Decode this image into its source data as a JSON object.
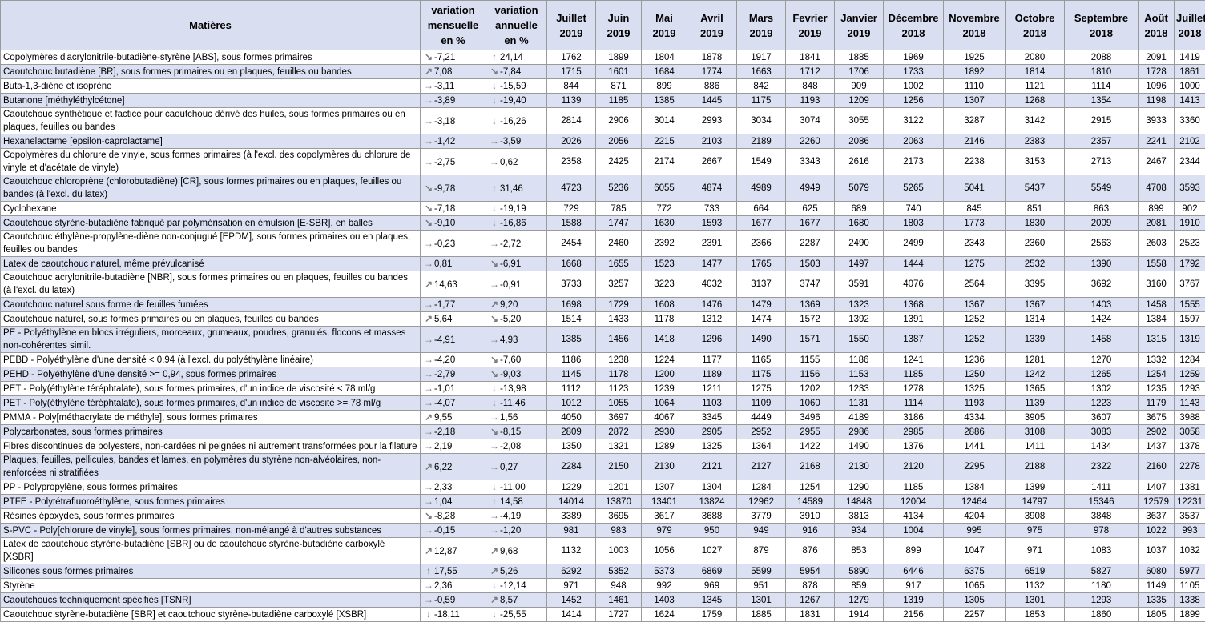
{
  "headers": {
    "matieres": "Matières",
    "var_mensuelle": [
      "variation",
      "mensuelle",
      "en %"
    ],
    "var_annuelle": [
      "variation",
      "annuelle",
      "en %"
    ],
    "months": [
      [
        "Juillet",
        "2019"
      ],
      [
        "Juin",
        "2019"
      ],
      [
        "Mai",
        "2019"
      ],
      [
        "Avril",
        "2019"
      ],
      [
        "Mars",
        "2019"
      ],
      [
        "Fevrier",
        "2019"
      ],
      [
        "Janvier",
        "2019"
      ],
      [
        "Décembre",
        "2018"
      ],
      [
        "Novembre",
        "2018"
      ],
      [
        "Octobre",
        "2018"
      ],
      [
        "Septembre",
        "2018"
      ],
      [
        "Août",
        "2018"
      ],
      [
        "Juillet",
        "2018"
      ]
    ]
  },
  "rows": [
    {
      "name": "Copolymères d'acrylonitrile-butadiène-styrène [ABS], sous formes primaires",
      "vm": "-7,21",
      "vm_dir": "down-right",
      "va": "24,14",
      "va_dir": "up",
      "values": [
        "1762",
        "1899",
        "1804",
        "1878",
        "1917",
        "1841",
        "1885",
        "1969",
        "1925",
        "2080",
        "2088",
        "2091",
        "1419"
      ]
    },
    {
      "name": "Caoutchouc butadiène [BR], sous formes primaires ou en plaques, feuilles ou bandes",
      "vm": "7,08",
      "vm_dir": "up-right",
      "va": "-7,84",
      "va_dir": "down-right",
      "values": [
        "1715",
        "1601",
        "1684",
        "1774",
        "1663",
        "1712",
        "1706",
        "1733",
        "1892",
        "1814",
        "1810",
        "1728",
        "1861"
      ]
    },
    {
      "name": "Buta-1,3-diène et isoprène",
      "vm": "-3,11",
      "vm_dir": "right",
      "va": "-15,59",
      "va_dir": "down",
      "values": [
        "844",
        "871",
        "899",
        "886",
        "842",
        "848",
        "909",
        "1002",
        "1110",
        "1121",
        "1114",
        "1096",
        "1000"
      ]
    },
    {
      "name": "Butanone [méthyléthylcétone]",
      "vm": "-3,89",
      "vm_dir": "right",
      "va": "-19,40",
      "va_dir": "down",
      "values": [
        "1139",
        "1185",
        "1385",
        "1445",
        "1175",
        "1193",
        "1209",
        "1256",
        "1307",
        "1268",
        "1354",
        "1198",
        "1413"
      ]
    },
    {
      "name": "Caoutchouc synthétique et factice pour caoutchouc dérivé des huiles, sous formes primaires ou en plaques, feuilles ou bandes",
      "vm": "-3,18",
      "vm_dir": "right",
      "va": "-16,26",
      "va_dir": "down",
      "values": [
        "2814",
        "2906",
        "3014",
        "2993",
        "3034",
        "3074",
        "3055",
        "3122",
        "3287",
        "3142",
        "2915",
        "3933",
        "3360"
      ]
    },
    {
      "name": "Hexanelactame [epsilon-caprolactame]",
      "vm": "-1,42",
      "vm_dir": "right",
      "va": "-3,59",
      "va_dir": "right",
      "values": [
        "2026",
        "2056",
        "2215",
        "2103",
        "2189",
        "2260",
        "2086",
        "2063",
        "2146",
        "2383",
        "2357",
        "2241",
        "2102"
      ]
    },
    {
      "name": "Copolymères du chlorure de vinyle, sous formes primaires (à l'excl. des copolymères du chlorure de vinyle et d'acétate de vinyle)",
      "vm": "-2,75",
      "vm_dir": "right",
      "va": "0,62",
      "va_dir": "right",
      "values": [
        "2358",
        "2425",
        "2174",
        "2667",
        "1549",
        "3343",
        "2616",
        "2173",
        "2238",
        "3153",
        "2713",
        "2467",
        "2344"
      ]
    },
    {
      "name": "Caoutchouc chloroprène (chlorobutadiène) [CR], sous formes primaires ou en plaques, feuilles ou bandes (à l'excl. du latex)",
      "vm": "-9,78",
      "vm_dir": "down-right",
      "va": "31,46",
      "va_dir": "up",
      "values": [
        "4723",
        "5236",
        "6055",
        "4874",
        "4989",
        "4949",
        "5079",
        "5265",
        "5041",
        "5437",
        "5549",
        "4708",
        "3593"
      ]
    },
    {
      "name": "Cyclohexane",
      "vm": "-7,18",
      "vm_dir": "down-right",
      "va": "-19,19",
      "va_dir": "down",
      "values": [
        "729",
        "785",
        "772",
        "733",
        "664",
        "625",
        "689",
        "740",
        "845",
        "851",
        "863",
        "899",
        "902"
      ]
    },
    {
      "name": "Caoutchouc styrène-butadiène fabriqué par polymérisation en émulsion [E-SBR], en balles",
      "vm": "-9,10",
      "vm_dir": "down-right",
      "va": "-16,86",
      "va_dir": "down",
      "values": [
        "1588",
        "1747",
        "1630",
        "1593",
        "1677",
        "1677",
        "1680",
        "1803",
        "1773",
        "1830",
        "2009",
        "2081",
        "1910"
      ]
    },
    {
      "name": "Caoutchouc éthylène-propylène-diène non-conjugué [EPDM], sous formes primaires ou en plaques, feuilles ou bandes",
      "vm": "-0,23",
      "vm_dir": "right",
      "va": "-2,72",
      "va_dir": "right",
      "values": [
        "2454",
        "2460",
        "2392",
        "2391",
        "2366",
        "2287",
        "2490",
        "2499",
        "2343",
        "2360",
        "2563",
        "2603",
        "2523"
      ]
    },
    {
      "name": "Latex de caoutchouc naturel, même prévulcanisé",
      "vm": "0,81",
      "vm_dir": "right",
      "va": "-6,91",
      "va_dir": "down-right",
      "values": [
        "1668",
        "1655",
        "1523",
        "1477",
        "1765",
        "1503",
        "1497",
        "1444",
        "1275",
        "2532",
        "1390",
        "1558",
        "1792"
      ]
    },
    {
      "name": "Caoutchouc acrylonitrile-butadiène [NBR], sous formes primaires ou en plaques, feuilles ou bandes (à l'excl. du latex)",
      "vm": "14,63",
      "vm_dir": "up-right",
      "va": "-0,91",
      "va_dir": "right",
      "values": [
        "3733",
        "3257",
        "3223",
        "4032",
        "3137",
        "3747",
        "3591",
        "4076",
        "2564",
        "3395",
        "3692",
        "3160",
        "3767"
      ]
    },
    {
      "name": "Caoutchouc naturel sous forme de feuilles fumées",
      "vm": "-1,77",
      "vm_dir": "right",
      "va": "9,20",
      "va_dir": "up-right",
      "values": [
        "1698",
        "1729",
        "1608",
        "1476",
        "1479",
        "1369",
        "1323",
        "1368",
        "1367",
        "1367",
        "1403",
        "1458",
        "1555"
      ]
    },
    {
      "name": "Caoutchouc naturel, sous formes primaires ou en plaques, feuilles ou bandes",
      "vm": "5,64",
      "vm_dir": "up-right",
      "va": "-5,20",
      "va_dir": "down-right",
      "values": [
        "1514",
        "1433",
        "1178",
        "1312",
        "1474",
        "1572",
        "1392",
        "1391",
        "1252",
        "1314",
        "1424",
        "1384",
        "1597"
      ]
    },
    {
      "name": "PE - Polyéthylène en blocs irréguliers, morceaux, grumeaux, poudres, granulés, flocons et masses non-cohérentes simil.",
      "vm": "-4,91",
      "vm_dir": "right",
      "va": "4,93",
      "va_dir": "right",
      "values": [
        "1385",
        "1456",
        "1418",
        "1296",
        "1490",
        "1571",
        "1550",
        "1387",
        "1252",
        "1339",
        "1458",
        "1315",
        "1319"
      ]
    },
    {
      "name": "PEBD - Polyéthylène d'une densité < 0,94 (à l'excl. du polyéthylène linéaire)",
      "vm": "-4,20",
      "vm_dir": "right",
      "va": "-7,60",
      "va_dir": "down-right",
      "values": [
        "1186",
        "1238",
        "1224",
        "1177",
        "1165",
        "1155",
        "1186",
        "1241",
        "1236",
        "1281",
        "1270",
        "1332",
        "1284"
      ]
    },
    {
      "name": "PEHD - Polyéthylène d'une densité >= 0,94, sous formes primaires",
      "vm": "-2,79",
      "vm_dir": "right",
      "va": "-9,03",
      "va_dir": "down-right",
      "values": [
        "1145",
        "1178",
        "1200",
        "1189",
        "1175",
        "1156",
        "1153",
        "1185",
        "1250",
        "1242",
        "1265",
        "1254",
        "1259"
      ]
    },
    {
      "name": "PET - Poly(éthylène téréphtalate), sous formes primaires, d'un indice de viscosité < 78 ml/g",
      "vm": "-1,01",
      "vm_dir": "right",
      "va": "-13,98",
      "va_dir": "down",
      "values": [
        "1112",
        "1123",
        "1239",
        "1211",
        "1275",
        "1202",
        "1233",
        "1278",
        "1325",
        "1365",
        "1302",
        "1235",
        "1293"
      ]
    },
    {
      "name": "PET - Poly(éthylène téréphtalate), sous formes primaires, d'un indice de viscosité >= 78 ml/g",
      "vm": "-4,07",
      "vm_dir": "right",
      "va": "-11,46",
      "va_dir": "down",
      "values": [
        "1012",
        "1055",
        "1064",
        "1103",
        "1109",
        "1060",
        "1131",
        "1114",
        "1193",
        "1139",
        "1223",
        "1179",
        "1143"
      ]
    },
    {
      "name": "PMMA - Poly[méthacrylate de méthyle], sous formes primaires",
      "vm": "9,55",
      "vm_dir": "up-right",
      "va": "1,56",
      "va_dir": "right",
      "values": [
        "4050",
        "3697",
        "4067",
        "3345",
        "4449",
        "3496",
        "4189",
        "3186",
        "4334",
        "3905",
        "3607",
        "3675",
        "3988"
      ]
    },
    {
      "name": "Polycarbonates, sous formes primaires",
      "vm": "-2,18",
      "vm_dir": "right",
      "va": "-8,15",
      "va_dir": "down-right",
      "values": [
        "2809",
        "2872",
        "2930",
        "2905",
        "2952",
        "2955",
        "2986",
        "2985",
        "2886",
        "3108",
        "3083",
        "2902",
        "3058"
      ]
    },
    {
      "name": "Fibres discontinues de polyesters, non-cardées ni peignées ni autrement transformées pour la filature",
      "vm": "2,19",
      "vm_dir": "right",
      "va": "-2,08",
      "va_dir": "right",
      "values": [
        "1350",
        "1321",
        "1289",
        "1325",
        "1364",
        "1422",
        "1490",
        "1376",
        "1441",
        "1411",
        "1434",
        "1437",
        "1378"
      ]
    },
    {
      "name": "Plaques, feuilles, pellicules, bandes et lames, en polymères du styrène non-alvéolaires, non-renforcées ni stratifiées",
      "vm": "6,22",
      "vm_dir": "up-right",
      "va": "0,27",
      "va_dir": "right",
      "values": [
        "2284",
        "2150",
        "2130",
        "2121",
        "2127",
        "2168",
        "2130",
        "2120",
        "2295",
        "2188",
        "2322",
        "2160",
        "2278"
      ]
    },
    {
      "name": "PP - Polypropylène, sous formes primaires",
      "vm": "2,33",
      "vm_dir": "right",
      "va": "-11,00",
      "va_dir": "down",
      "values": [
        "1229",
        "1201",
        "1307",
        "1304",
        "1284",
        "1254",
        "1290",
        "1185",
        "1384",
        "1399",
        "1411",
        "1407",
        "1381"
      ]
    },
    {
      "name": "PTFE - Polytétrafluoroéthylène, sous formes primaires",
      "vm": "1,04",
      "vm_dir": "right",
      "va": "14,58",
      "va_dir": "up",
      "values": [
        "14014",
        "13870",
        "13401",
        "13824",
        "12962",
        "14589",
        "14848",
        "12004",
        "12464",
        "14797",
        "15346",
        "12579",
        "12231"
      ]
    },
    {
      "name": "Résines époxydes, sous formes primaires",
      "vm": "-8,28",
      "vm_dir": "down-right",
      "va": "-4,19",
      "va_dir": "right",
      "values": [
        "3389",
        "3695",
        "3617",
        "3688",
        "3779",
        "3910",
        "3813",
        "4134",
        "4204",
        "3908",
        "3848",
        "3637",
        "3537"
      ]
    },
    {
      "name": "S-PVC - Poly[chlorure de vinyle], sous formes primaires, non-mélangé à d'autres substances",
      "vm": "-0,15",
      "vm_dir": "right",
      "va": "-1,20",
      "va_dir": "right",
      "values": [
        "981",
        "983",
        "979",
        "950",
        "949",
        "916",
        "934",
        "1004",
        "995",
        "975",
        "978",
        "1022",
        "993"
      ]
    },
    {
      "name": "Latex de caoutchouc styrène-butadiène [SBR] ou de caoutchouc styrène-butadiène carboxylé [XSBR]",
      "vm": "12,87",
      "vm_dir": "up-right",
      "va": "9,68",
      "va_dir": "up-right",
      "values": [
        "1132",
        "1003",
        "1056",
        "1027",
        "879",
        "876",
        "853",
        "899",
        "1047",
        "971",
        "1083",
        "1037",
        "1032"
      ]
    },
    {
      "name": "Silicones sous formes primaires",
      "vm": "17,55",
      "vm_dir": "up",
      "va": "5,26",
      "va_dir": "up-right",
      "values": [
        "6292",
        "5352",
        "5373",
        "6869",
        "5599",
        "5954",
        "5890",
        "6446",
        "6375",
        "6519",
        "5827",
        "6080",
        "5977"
      ]
    },
    {
      "name": "Styrène",
      "vm": "2,36",
      "vm_dir": "right",
      "va": "-12,14",
      "va_dir": "down",
      "values": [
        "971",
        "948",
        "992",
        "969",
        "951",
        "878",
        "859",
        "917",
        "1065",
        "1132",
        "1180",
        "1149",
        "1105"
      ]
    },
    {
      "name": "Caoutchoucs techniquement spécifiés [TSNR]",
      "vm": "-0,59",
      "vm_dir": "right",
      "va": "8,57",
      "va_dir": "up-right",
      "values": [
        "1452",
        "1461",
        "1403",
        "1345",
        "1301",
        "1267",
        "1279",
        "1319",
        "1305",
        "1301",
        "1293",
        "1335",
        "1338"
      ]
    },
    {
      "name": "Caoutchouc styrène-butadiène [SBR] et caoutchouc styrène-butadiène carboxylé [XSBR]",
      "vm": "-18,11",
      "vm_dir": "down",
      "va": "-25,55",
      "va_dir": "down",
      "values": [
        "1414",
        "1727",
        "1624",
        "1759",
        "1885",
        "1831",
        "1914",
        "2156",
        "2257",
        "1853",
        "1860",
        "1805",
        "1899"
      ]
    }
  ],
  "arrow_glyphs": {
    "up": "↑",
    "up-right": "↗",
    "right": "→",
    "down-right": "↘",
    "down": "↓"
  },
  "colors": {
    "header_bg": "#d9def0",
    "band_bg": "#dbe0f2",
    "arrow": "#7a7a7a"
  }
}
